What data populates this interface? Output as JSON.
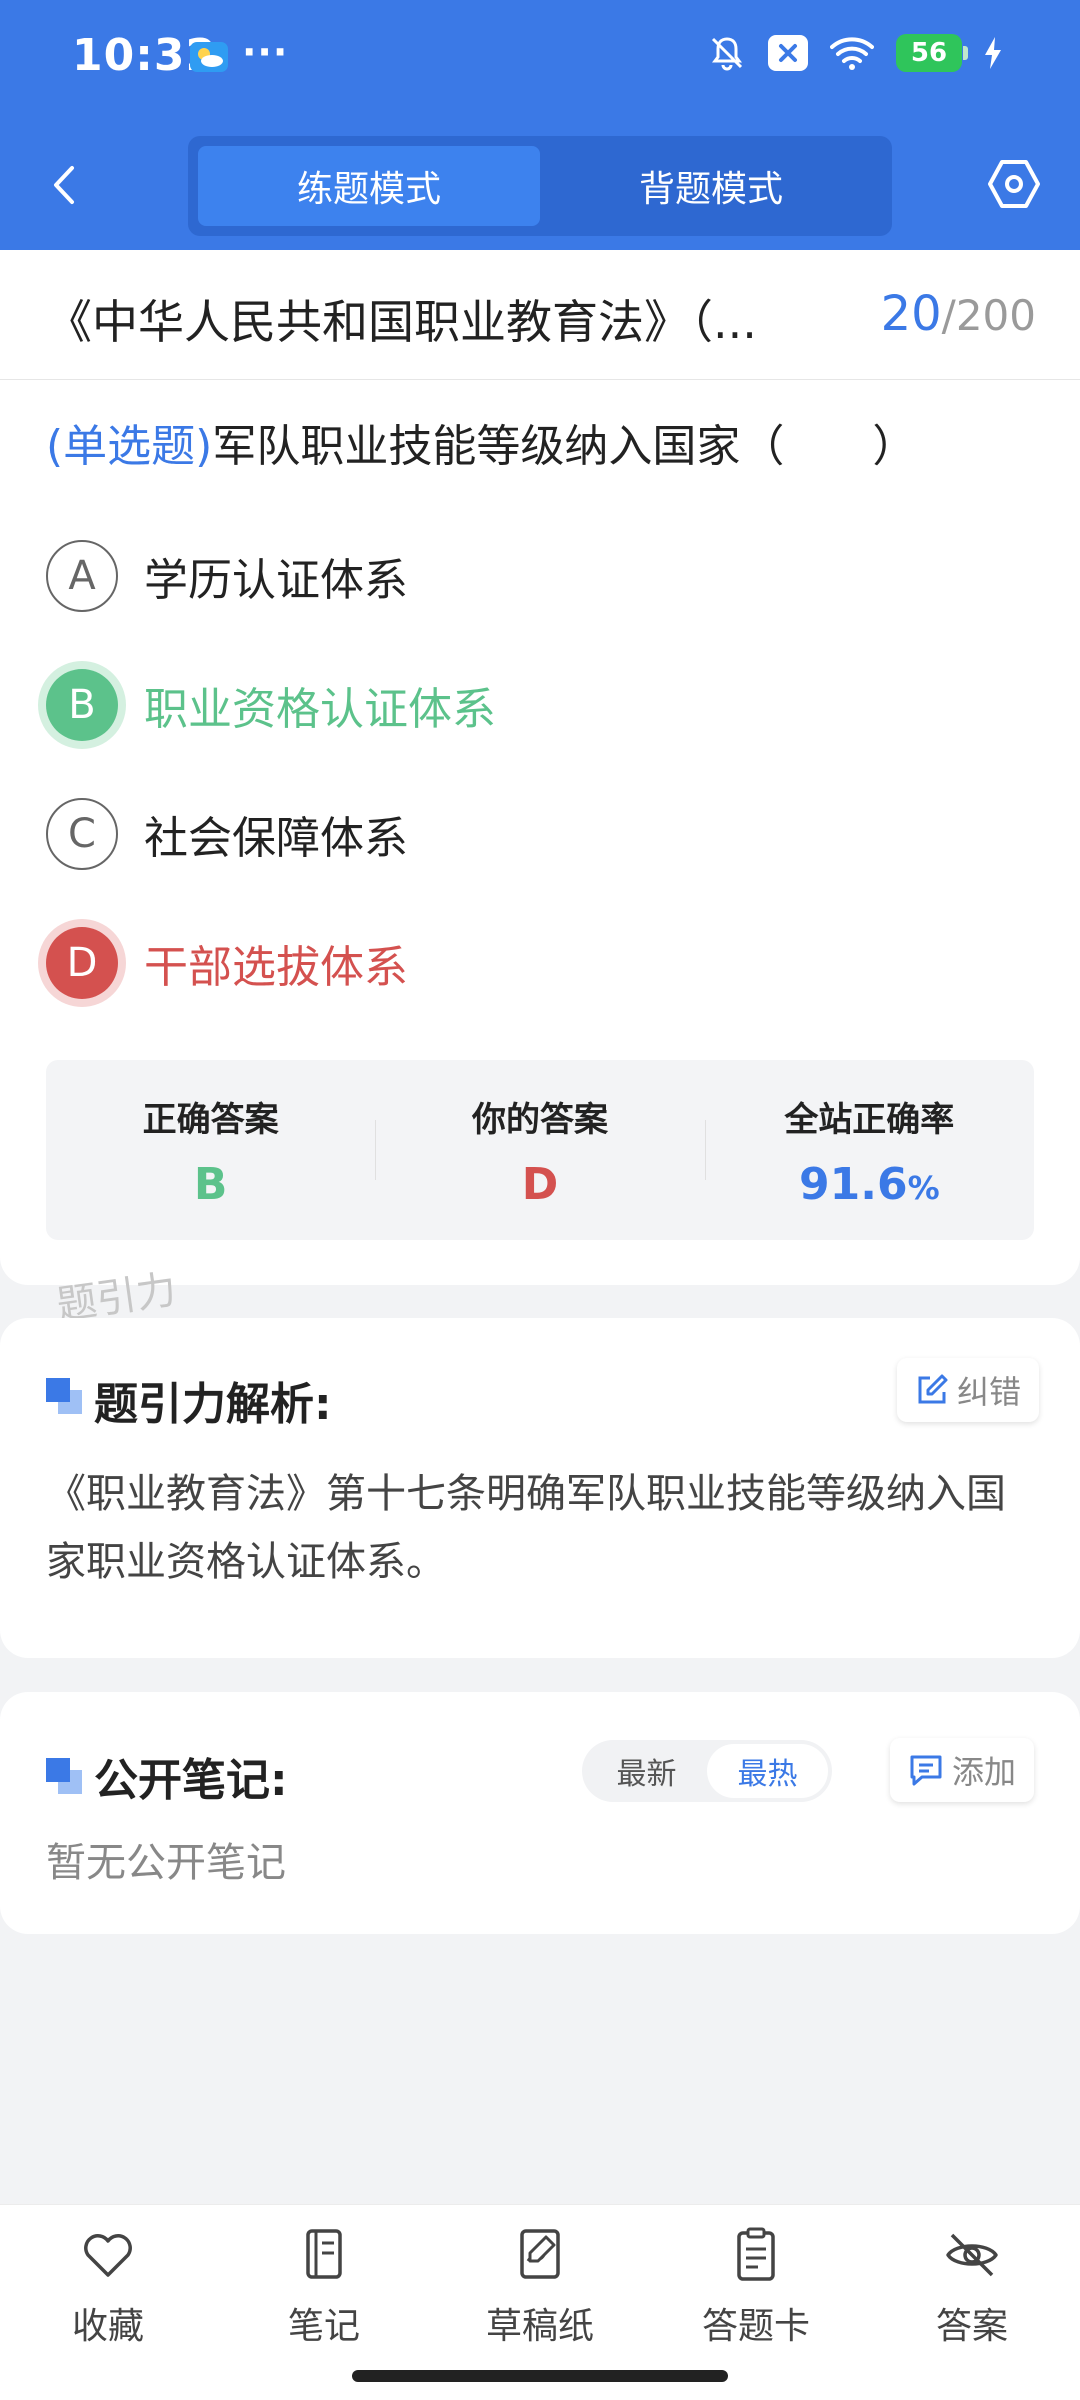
{
  "status_bar": {
    "time": "10:32",
    "more": "···",
    "battery": "56"
  },
  "nav": {
    "tabs": [
      {
        "label": "练题模式",
        "active": true
      },
      {
        "label": "背题模式",
        "active": false
      }
    ]
  },
  "title_row": {
    "title": "《中华人民共和国职业教育法》（...",
    "current": "20",
    "separator": "/",
    "total": "200"
  },
  "question": {
    "type": "(单选题)",
    "stem": "军队职业技能等级纳入国家（　　）",
    "options": [
      {
        "letter": "A",
        "text": "学历认证体系",
        "state": "normal"
      },
      {
        "letter": "B",
        "text": "职业资格认证体系",
        "state": "correct"
      },
      {
        "letter": "C",
        "text": "社会保障体系",
        "state": "normal"
      },
      {
        "letter": "D",
        "text": "干部选拔体系",
        "state": "wrong"
      }
    ]
  },
  "result": {
    "correct_label": "正确答案",
    "correct_value": "B",
    "yours_label": "你的答案",
    "yours_value": "D",
    "rate_label": "全站正确率",
    "rate_value": "91.6",
    "rate_unit": "%"
  },
  "watermark": "题引力",
  "analysis": {
    "title": "题引力解析:",
    "report_label": "纠错",
    "text": "《职业教育法》第十七条明确军队职业技能等级纳入国家职业资格认证体系。"
  },
  "notes": {
    "title": "公开笔记:",
    "sort_newest": "最新",
    "sort_hottest": "最热",
    "add_label": "添加",
    "empty": "暂无公开笔记"
  },
  "bottom_bar": {
    "items": [
      {
        "label": "收藏",
        "icon": "heart-icon"
      },
      {
        "label": "笔记",
        "icon": "notebook-icon"
      },
      {
        "label": "草稿纸",
        "icon": "draft-icon"
      },
      {
        "label": "答题卡",
        "icon": "answer-sheet-icon"
      },
      {
        "label": "答案",
        "icon": "eye-off-icon"
      }
    ]
  },
  "colors": {
    "brand": "#3b79e6",
    "correct": "#5cc28b",
    "wrong": "#d4514f"
  }
}
